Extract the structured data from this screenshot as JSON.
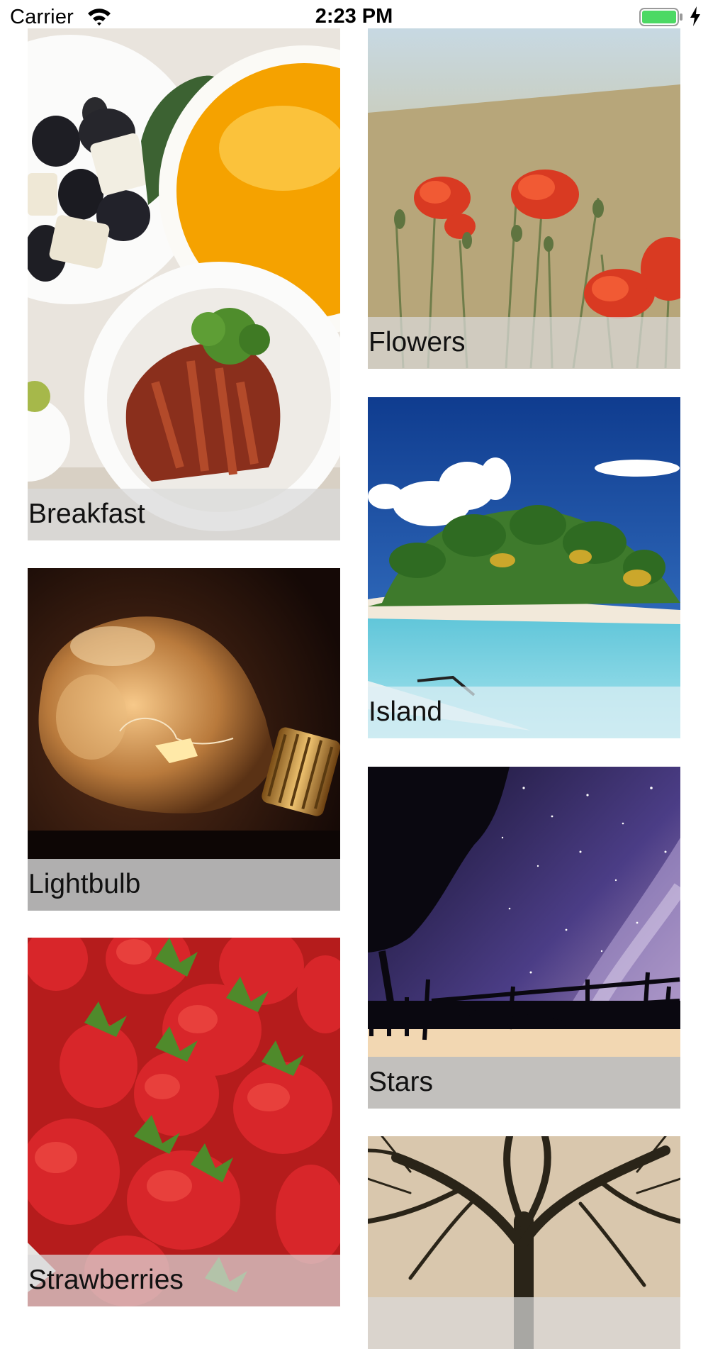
{
  "status_bar": {
    "carrier": "Carrier",
    "time": "2:23 PM",
    "icons": [
      "wifi-icon",
      "battery-icon",
      "charging-icon"
    ],
    "battery_color": "#4cd964"
  },
  "photos": [
    {
      "id": "breakfast",
      "caption": "Breakfast"
    },
    {
      "id": "flowers",
      "caption": "Flowers"
    },
    {
      "id": "island",
      "caption": "Island"
    },
    {
      "id": "lightbulb",
      "caption": "Lightbulb"
    },
    {
      "id": "stars",
      "caption": "Stars"
    },
    {
      "id": "strawberries",
      "caption": "Strawberries"
    },
    {
      "id": "tree",
      "caption": ""
    }
  ]
}
